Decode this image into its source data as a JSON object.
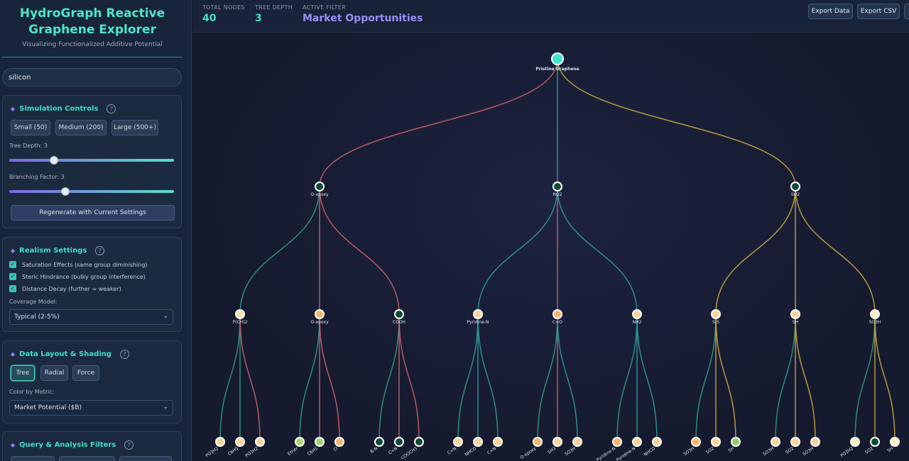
{
  "sidebar": {
    "title": "HydroGraph Reactive Graphene Explorer",
    "subtitle": "Visualizing Functionalized Additive Potential",
    "search_value": "silicon",
    "simulation": {
      "title": "Simulation Controls",
      "help": "?",
      "size_buttons": [
        "Small (50)",
        "Medium (200)",
        "Large (500+)"
      ],
      "tree_depth_label": "Tree Depth: 3",
      "tree_depth_value": 0.27,
      "branching_label": "Branching Factor: 3",
      "branching_value": 0.34,
      "regenerate_label": "Regenerate with Current Settings"
    },
    "realism": {
      "title": "Realism Settings",
      "help": "?",
      "checks": [
        "Saturation Effects (same group diminishing)",
        "Steric Hindrance (bulky group interference)",
        "Distance Decay (further = weaker)"
      ],
      "check_mark": "✓",
      "coverage_label": "Coverage Model:",
      "coverage_value": "Typical (2-5%)"
    },
    "layout": {
      "title": "Data Layout & Shading",
      "help": "?",
      "layout_buttons": [
        "Tree",
        "Radial",
        "Force"
      ],
      "color_label": "Color by Metric:",
      "color_value": "Market Potential ($B)"
    },
    "query": {
      "title": "Query & Analysis Filters",
      "help": "?"
    }
  },
  "header": {
    "total_nodes_label": "TOTAL NODES",
    "total_nodes_value": "40",
    "tree_depth_label": "TREE DEPTH",
    "tree_depth_value": "3",
    "active_filter_label": "ACTIVE FILTER",
    "active_filter_value": "Market Opportunities",
    "export_data_label": "Export Data",
    "export_csv_label": "Export CSV"
  },
  "tree": {
    "root": "Pristine Graphene",
    "branches": [
      {
        "label": "O-epoxy",
        "color": "#c9606a",
        "children": [
          {
            "label": "P(CH)2",
            "color": "#2f9a86",
            "kids": [
              "PO3H2",
              "C6H5",
              "PO3H2"
            ]
          },
          {
            "label": "O-epoxy",
            "color": "#c9606a",
            "kids": [
              "Ether",
              "C6H5",
              "Cl"
            ]
          },
          {
            "label": "COOH",
            "color": "#c9606a",
            "kids": [
              "B-N",
              "C=N",
              "COOCH3"
            ]
          }
        ]
      },
      {
        "label": "NO2",
        "color": "#2f9a9a",
        "children": [
          {
            "label": "Pyridine-N",
            "color": "#2f9a9a",
            "kids": [
              "C=N",
              "NHCO",
              "C=N"
            ]
          },
          {
            "label": "C=O",
            "color": "#c9606a",
            "kids": [
              "O-epoxy",
              "SH3",
              "SO3H"
            ]
          },
          {
            "label": "NH2",
            "color": "#2f9a9a",
            "kids": [
              "Pyridine-N",
              "Pyridine-N",
              "NHCO"
            ]
          }
        ]
      },
      {
        "label": "SO2",
        "color": "#c9a742",
        "children": [
          {
            "label": "S-S",
            "color": "#c9a742",
            "kids": [
              "SO3H",
              "SO2",
              "SH"
            ]
          },
          {
            "label": "SH",
            "color": "#c9a742",
            "kids": [
              "SO3H",
              "SO2",
              "SO3H"
            ]
          },
          {
            "label": "SO3H",
            "color": "#c9a742",
            "kids": [
              "PO3H2",
              "SO2",
              "SH"
            ]
          }
        ]
      }
    ],
    "node_fills": {
      "root": "#3fe6c8",
      "level1": [
        "dark",
        "dark",
        "dark"
      ],
      "level2": [
        "#f6e3a4",
        "#f4b46a",
        "dark",
        "#f6d39a",
        "#f4b46a",
        "#f6d39a",
        "#f6d39a",
        "#f6d39a",
        "#fbefc0"
      ],
      "level3": [
        "#f6d39a",
        "#f6d39a",
        "#f6d39a",
        "#a6d86e",
        "#9bd46a",
        "#f4b46a",
        "dark",
        "dark",
        "dark",
        "#f6d39a",
        "#f6d39a",
        "#f6d39a",
        "#f4b46a",
        "#f6d39a",
        "#f6d39a",
        "#f4b46a",
        "#f6d39a",
        "#f6d39a",
        "#f4b46a",
        "#f6d39a",
        "#8fd06a",
        "#f6d39a",
        "#f6d39a",
        "#f6d39a",
        "#fbefc0",
        "dark",
        "#fbefc0"
      ]
    }
  }
}
